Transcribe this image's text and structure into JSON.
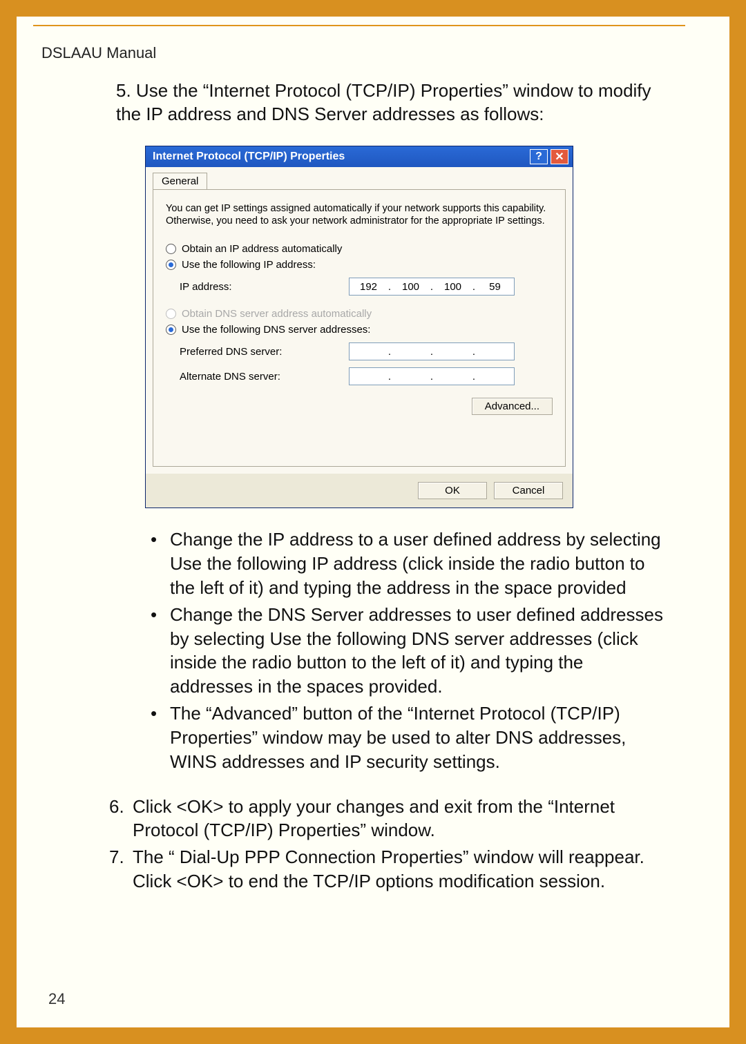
{
  "manual_title": "DSLAAU Manual",
  "step5_num": "5.",
  "step5_text": "Use the “Internet Protocol (TCP/IP) Properties” window to modify the IP address and DNS Server addresses as follows:",
  "dialog": {
    "title": "Internet Protocol (TCP/IP) Properties",
    "help": "?",
    "close": "✕",
    "tab": "General",
    "desc": "You can get IP settings assigned automatically if your network supports this capability. Otherwise, you need to ask your network administrator for the appropriate IP settings.",
    "ip_auto": "Obtain an IP address automatically",
    "ip_manual": "Use the following IP address:",
    "ip_label": "IP address:",
    "ip_value": [
      "192",
      "100",
      "100",
      "59"
    ],
    "dns_auto": "Obtain DNS server address automatically",
    "dns_manual": "Use the following DNS server addresses:",
    "pref_dns": "Preferred DNS server:",
    "alt_dns": "Alternate DNS server:",
    "advanced": "Advanced...",
    "ok": "OK",
    "cancel": "Cancel"
  },
  "bullets": [
    "Change the IP address to a user defined address by selecting Use the following IP address (click inside the radio button to the left of it) and typing the address in the space provided",
    "Change the DNS Server addresses to user defined addresses by selecting Use the following DNS server addresses (click inside the radio button to the left of it) and typing the addresses in the spaces provided.",
    "The “Advanced” button of the “Internet Protocol (TCP/IP) Properties” window may be used to alter DNS addresses, WINS addresses and IP security settings."
  ],
  "step6_num": "6.",
  "step6_text": "Click <OK> to apply your changes and exit from the “Internet Protocol (TCP/IP) Properties” window.",
  "step7_num": "7.",
  "step7_text": "The “ Dial-Up PPP Connection Properties” window will reappear. Click <OK> to end the TCP/IP options modification session.",
  "page_number": "24"
}
